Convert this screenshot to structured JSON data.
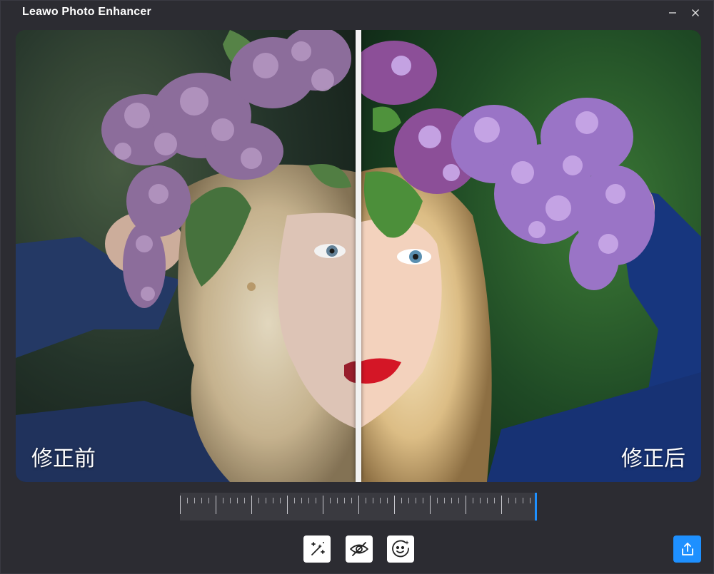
{
  "window": {
    "title": "Leawo Photo Enhancer"
  },
  "preview": {
    "before_label": "修正前",
    "after_label": "修正后",
    "split_position": 0.5
  },
  "timeline": {
    "position": 1.0,
    "accent_color": "#1e90ff"
  },
  "toolbar": {
    "tools": [
      {
        "icon": "magic-wand-icon"
      },
      {
        "icon": "eye-icon"
      },
      {
        "icon": "face-enhance-icon"
      }
    ],
    "export_icon": "share-export-icon",
    "export_color": "#1e90ff"
  }
}
